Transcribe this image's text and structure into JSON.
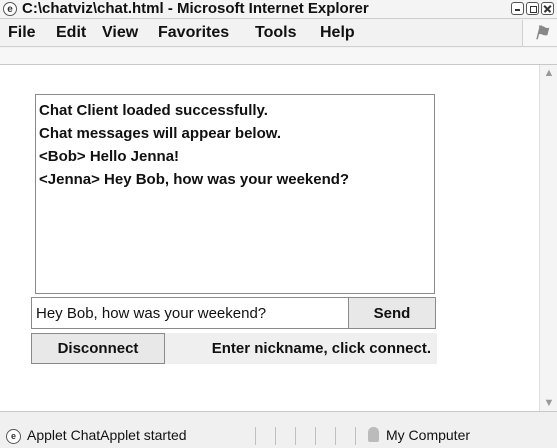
{
  "window": {
    "title": "C:\\chatviz\\chat.html - Microsoft Internet Explorer",
    "icon": "ie-icon"
  },
  "menu": {
    "items": [
      {
        "label": "File"
      },
      {
        "label": "Edit"
      },
      {
        "label": "View"
      },
      {
        "label": "Favorites"
      },
      {
        "label": "Tools"
      },
      {
        "label": "Help"
      }
    ]
  },
  "chat": {
    "messages": [
      "Chat Client loaded successfully.",
      "Chat messages will appear below.",
      "<Bob> Hello Jenna!",
      "<Jenna> Hey Bob, how was your weekend?"
    ],
    "input_value": "Hey Bob, how was your weekend?",
    "send_label": "Send",
    "disconnect_label": "Disconnect",
    "status_text": "Enter nickname, click connect."
  },
  "statusbar": {
    "text": "Applet ChatApplet started",
    "zone": "My Computer"
  }
}
